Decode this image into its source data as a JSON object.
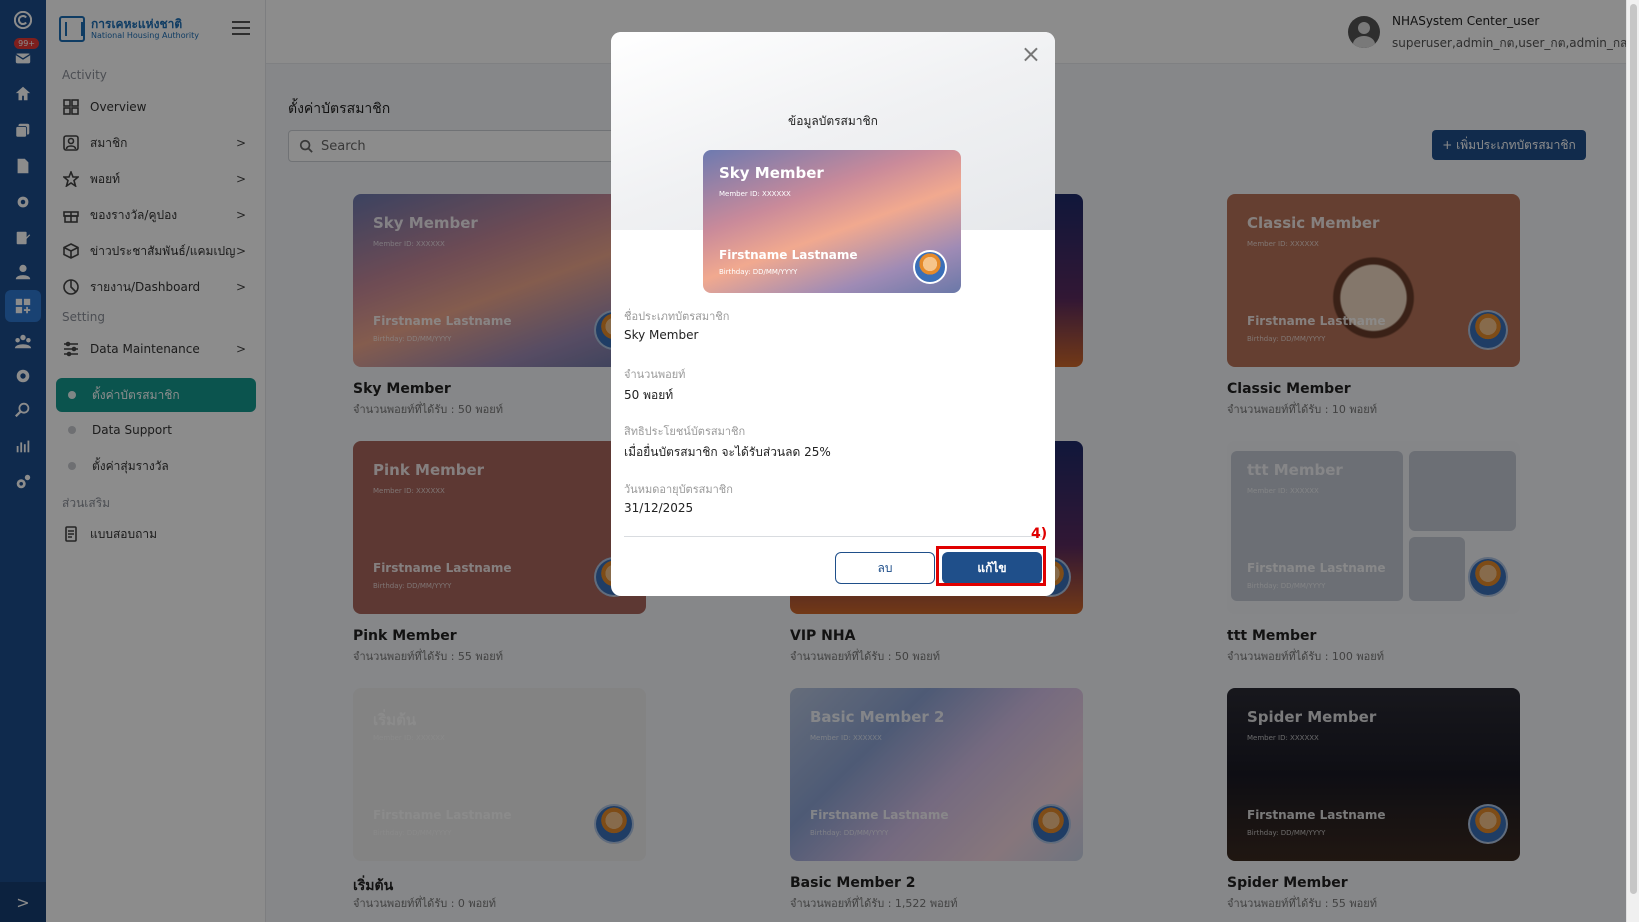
{
  "rail": {
    "badge": "99+",
    "expand_icon": ">"
  },
  "sidebar": {
    "logo_line1": "การเคหะแห่งชาติ",
    "logo_line2": "National Housing Authority",
    "section_activity": "Activity",
    "section_setting": "Setting",
    "section_addon": "ส่วนเสริม",
    "items": [
      {
        "label": "Overview",
        "icon": "grid-icon"
      },
      {
        "label": "สมาชิก",
        "icon": "user-card-icon",
        "chevron": ">"
      },
      {
        "label": "พอยท์",
        "icon": "star-icon",
        "chevron": ">"
      },
      {
        "label": "ของรางวัล/คูปอง",
        "icon": "gift-icon",
        "chevron": ">"
      },
      {
        "label": "ข่าวประชาสัมพันธ์/แคมเปญ",
        "icon": "cube-icon",
        "chevron": ">"
      },
      {
        "label": "รายงาน/Dashboard",
        "icon": "chart-pie-icon",
        "chevron": ">"
      },
      {
        "label": "Data Maintenance",
        "icon": "sliders-icon",
        "chevron": ">"
      },
      {
        "label": "ตั้งค่าบัตรสมาชิก",
        "active": true
      },
      {
        "label": "Data Support"
      },
      {
        "label": "ตั้งค่าสุ่มรางวัล"
      },
      {
        "label": "แบบสอบถาม",
        "icon": "document-icon"
      }
    ]
  },
  "header": {
    "user_name": "NHASystem Center_user",
    "user_roles": "superuser,admin_กต,user_กต,admin_กส"
  },
  "main": {
    "title": "ตั้งค่าบัตรสมาชิก",
    "search_placeholder": "Search",
    "add_button": "+ เพิ่มประเภทบัตรสมาชิก",
    "card_common": {
      "member_id": "Member ID: XXXXXX",
      "name": "Firstname Lastname",
      "birthday": "Birthday: DD/MM/YYYY"
    },
    "cards": [
      {
        "title": "Sky Member",
        "label": "Sky Member",
        "sub": "จำนวนพอยท์ที่ได้รับ : 50 พอยท์"
      },
      {
        "title": "",
        "label": "",
        "sub": ""
      },
      {
        "title": "Classic Member",
        "label": "Classic Member",
        "sub": "จำนวนพอยท์ที่ได้รับ : 10 พอยท์"
      },
      {
        "title": "Pink Member",
        "label": "Pink Member",
        "sub": "จำนวนพอยท์ที่ได้รับ : 55 พอยท์"
      },
      {
        "title": "",
        "label": "VIP NHA",
        "sub": "จำนวนพอยท์ที่ได้รับ : 50 พอยท์"
      },
      {
        "title": "ttt Member",
        "label": "ttt Member",
        "sub": "จำนวนพอยท์ที่ได้รับ : 100 พอยท์"
      },
      {
        "title": "เริ่มต้น",
        "label": "เริ่มต้น",
        "sub": "จำนวนพอยท์ที่ได้รับ : 0 พอยท์"
      },
      {
        "title": "Basic Member 2",
        "label": "Basic Member 2",
        "sub": "จำนวนพอยท์ที่ได้รับ : 1,522 พอยท์"
      },
      {
        "title": "Spider Member",
        "label": "Spider Member",
        "sub": "จำนวนพอยท์ที่ได้รับ : 55 พอยท์"
      }
    ]
  },
  "modal": {
    "title": "ข้อมูลบัตรสมาชิก",
    "close": "×",
    "card_title": "Sky Member",
    "card_id": "Member ID: XXXXXX",
    "card_name": "Firstname Lastname",
    "card_bday": "Birthday: DD/MM/YYYY",
    "fields": [
      {
        "label": "ชื่อประเภทบัตรสมาชิก",
        "value": "Sky Member"
      },
      {
        "label": "จำนวนพอยท์",
        "value": "50 พอยท์"
      },
      {
        "label": "สิทธิประโยชน์บัตรสมาชิก",
        "value": "เมื่อยื่นบัตรสมาชิก จะได้รับส่วนลด 25%"
      },
      {
        "label": "วันหมดอายุบัตรสมาชิก",
        "value": "31/12/2025"
      }
    ],
    "delete_button": "ลบ",
    "edit_button": "แก้ไข",
    "step_marker": "4)"
  },
  "colors": {
    "rail": "#1c4e8c",
    "active_sidebar": "#159a8f",
    "primary_button": "#1f4f8a",
    "highlight": "#e00000"
  }
}
